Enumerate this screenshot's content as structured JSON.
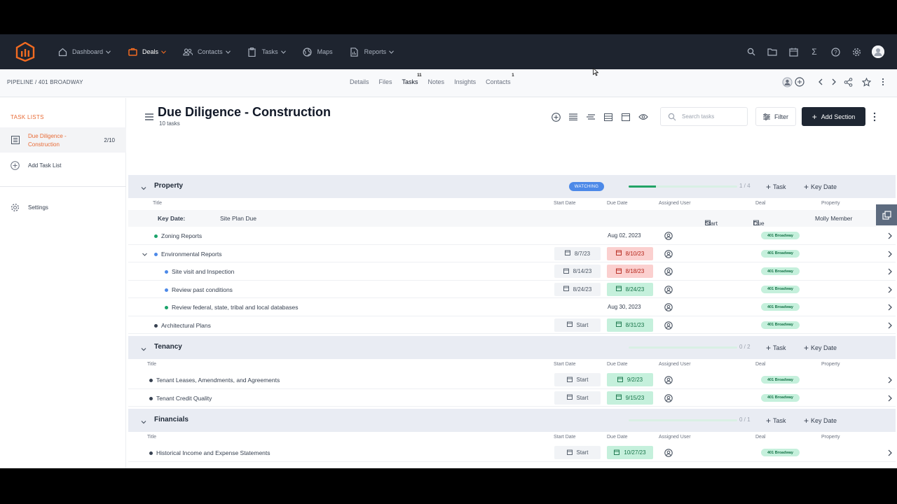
{
  "nav": {
    "items": [
      {
        "label": "Dashboard",
        "icon": "home-icon",
        "active": false
      },
      {
        "label": "Deals",
        "icon": "briefcase-icon",
        "active": true
      },
      {
        "label": "Contacts",
        "icon": "people-icon",
        "active": false
      },
      {
        "label": "Tasks",
        "icon": "clipboard-icon",
        "active": false
      },
      {
        "label": "Maps",
        "icon": "globe-icon",
        "active": false
      },
      {
        "label": "Reports",
        "icon": "report-icon",
        "active": false
      }
    ],
    "right_icons": [
      "search-icon",
      "folder-icon",
      "calendar-icon",
      "sigma-icon",
      "help-icon",
      "gear-icon",
      "avatar"
    ]
  },
  "subbar": {
    "breadcrumb": "PIPELINE / 401 BROADWAY",
    "tabs": [
      {
        "label": "Details",
        "count": ""
      },
      {
        "label": "Files",
        "count": ""
      },
      {
        "label": "Tasks",
        "count": "11"
      },
      {
        "label": "Notes",
        "count": ""
      },
      {
        "label": "Insights",
        "count": ""
      },
      {
        "label": "Contacts",
        "count": "1"
      }
    ]
  },
  "sidebar": {
    "heading": "TASK LISTS",
    "list_label": "Due Diligence - Construction",
    "list_count": "2/10",
    "add_label": "Add Task List",
    "settings_label": "Settings"
  },
  "header": {
    "title": "Due Diligence - Construction",
    "subtitle": "10 tasks",
    "search_placeholder": "Search tasks",
    "filter_label": "Filter",
    "add_section_label": "Add Section"
  },
  "columns": {
    "title": "Title",
    "start": "Start Date",
    "due": "Due Date",
    "user": "Assigned User",
    "deal": "Deal",
    "property": "Property"
  },
  "buttons": {
    "task": "Task",
    "key_date": "Key Date",
    "start": "Start",
    "due": "Due"
  },
  "sections": [
    {
      "title": "Property",
      "watching": "WATCHING",
      "progress_text": "1 / 4",
      "progress": 0.25,
      "key_date": {
        "label": "Key Date:",
        "name": "Site Plan Due",
        "assignee": "Molly Member"
      },
      "rows": [
        {
          "title": "Zoning Reports",
          "level": 0,
          "dot": "#1aa36a",
          "start": "",
          "due": "Aug 02, 2023",
          "due_style": "plain",
          "deal": "401 Broadway"
        },
        {
          "title": "Environmental Reports",
          "level": 0,
          "dot": "#4c89e8",
          "expand": true,
          "start": "8/7/23",
          "due": "8/10/23",
          "due_style": "red",
          "deal": "401 Broadway"
        },
        {
          "title": "Site visit and Inspection",
          "level": 1,
          "dot": "#4c89e8",
          "start": "8/14/23",
          "due": "8/18/23",
          "due_style": "red",
          "deal": "401 Broadway"
        },
        {
          "title": "Review past conditions",
          "level": 1,
          "dot": "#4c89e8",
          "start": "8/24/23",
          "due": "8/24/23",
          "due_style": "green",
          "deal": "401 Broadway"
        },
        {
          "title": "Review federal, state, tribal and local databases",
          "level": 1,
          "dot": "#1aa36a",
          "start": "",
          "due": "Aug 30, 2023",
          "due_style": "plain",
          "deal": "401 Broadway"
        },
        {
          "title": "Architectural Plans",
          "level": 0,
          "dot": "#374151",
          "start": "Start",
          "due": "8/31/23",
          "due_style": "green",
          "deal": "401 Broadway"
        }
      ]
    },
    {
      "title": "Tenancy",
      "progress_text": "0 / 2",
      "progress": 0,
      "rows": [
        {
          "title": "Tenant Leases, Amendments, and Agreements",
          "level": 0,
          "dot": "#374151",
          "start": "Start",
          "due": "9/2/23",
          "due_style": "green",
          "deal": "401 Broadway"
        },
        {
          "title": "Tenant Credit Quality",
          "level": 0,
          "dot": "#374151",
          "start": "Start",
          "due": "9/15/23",
          "due_style": "green",
          "deal": "401 Broadway"
        }
      ]
    },
    {
      "title": "Financials",
      "progress_text": "0 / 1",
      "progress": 0,
      "rows": [
        {
          "title": "Historical Income and Expense Statements",
          "level": 0,
          "dot": "#374151",
          "start": "Start",
          "due": "10/27/23",
          "due_style": "green",
          "deal": "401 Broadway"
        }
      ]
    }
  ],
  "colors": {
    "accent": "#e86b36",
    "nav_bg": "#1e242f",
    "watching": "#4c89e8",
    "green": "#22a366"
  }
}
